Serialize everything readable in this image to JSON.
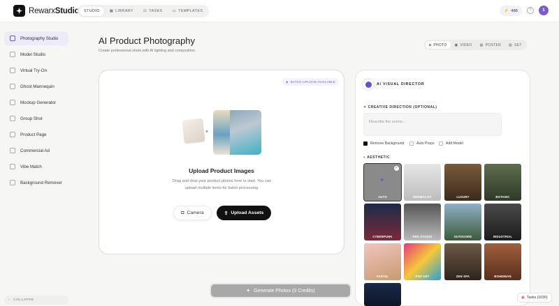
{
  "app": {
    "brand_prefix": "Rewarx",
    "brand_suffix": "Studio"
  },
  "topnav": [
    {
      "label": "STUDIO",
      "icon": "none",
      "active": true
    },
    {
      "label": "LIBRARY",
      "icon": "grid-icon",
      "active": false
    },
    {
      "label": "TASKS",
      "icon": "list-icon",
      "active": false
    },
    {
      "label": "TEMPLATES",
      "icon": "templates-icon",
      "active": false
    }
  ],
  "header": {
    "credits": "488",
    "help": "?",
    "avatar": "1"
  },
  "sidebar": {
    "items": [
      {
        "label": "Photography Studio",
        "active": true
      },
      {
        "label": "Model Studio"
      },
      {
        "label": "Virtual Try-On"
      },
      {
        "label": "Ghost Mannequin"
      },
      {
        "label": "Mockup Generator"
      },
      {
        "label": "Group Shot"
      },
      {
        "label": "Product Page"
      },
      {
        "label": "Commercial Ad"
      },
      {
        "label": "Vibe Match"
      },
      {
        "label": "Background Remover"
      }
    ],
    "collapse_label": "COLLAPSE"
  },
  "page": {
    "title": "AI Product Photography",
    "subtitle": "Create professional shots with AI lighting and composition.",
    "modes": [
      {
        "label": "PHOTO",
        "active": true
      },
      {
        "label": "VIDEO"
      },
      {
        "label": "POSTER"
      },
      {
        "label": "SET"
      }
    ]
  },
  "upload": {
    "batch_badge": "BATCH UPLOAD AVAILABLE",
    "heading": "Upload Product Images",
    "text": "Drag and drop your product photos here to start. You can upload multiple items for batch processing.",
    "camera_label": "Camera",
    "upload_label": "Upload Assets"
  },
  "director": {
    "title": "AI VISUAL DIRECTOR",
    "creative_label": "CREATIVE DIRECTION (OPTIONAL)",
    "scene_placeholder": "Describe the scene...",
    "options": [
      {
        "label": "Remove Background",
        "checked": true
      },
      {
        "label": "Auto Props",
        "checked": false
      },
      {
        "label": "Add Model",
        "checked": false
      }
    ],
    "aesthetic_label": "AESTHETIC",
    "aesthetics": [
      {
        "label": "AUTO",
        "selected": true
      },
      {
        "label": "MINIMALIST"
      },
      {
        "label": "LUXURY"
      },
      {
        "label": "BOTANIC"
      },
      {
        "label": "CYBERPUNK"
      },
      {
        "label": "PRO STUDIO"
      },
      {
        "label": "OUTDOORE"
      },
      {
        "label": "INDUSTRIAL"
      },
      {
        "label": "PASTEL"
      },
      {
        "label": "POP ART"
      },
      {
        "label": "ZEN SPA"
      },
      {
        "label": "BOHEMIAN"
      },
      {
        "label": ""
      }
    ]
  },
  "generate_label": "Generate Photos (0 Credits)",
  "tasks_label": "Tasks (1030)"
}
